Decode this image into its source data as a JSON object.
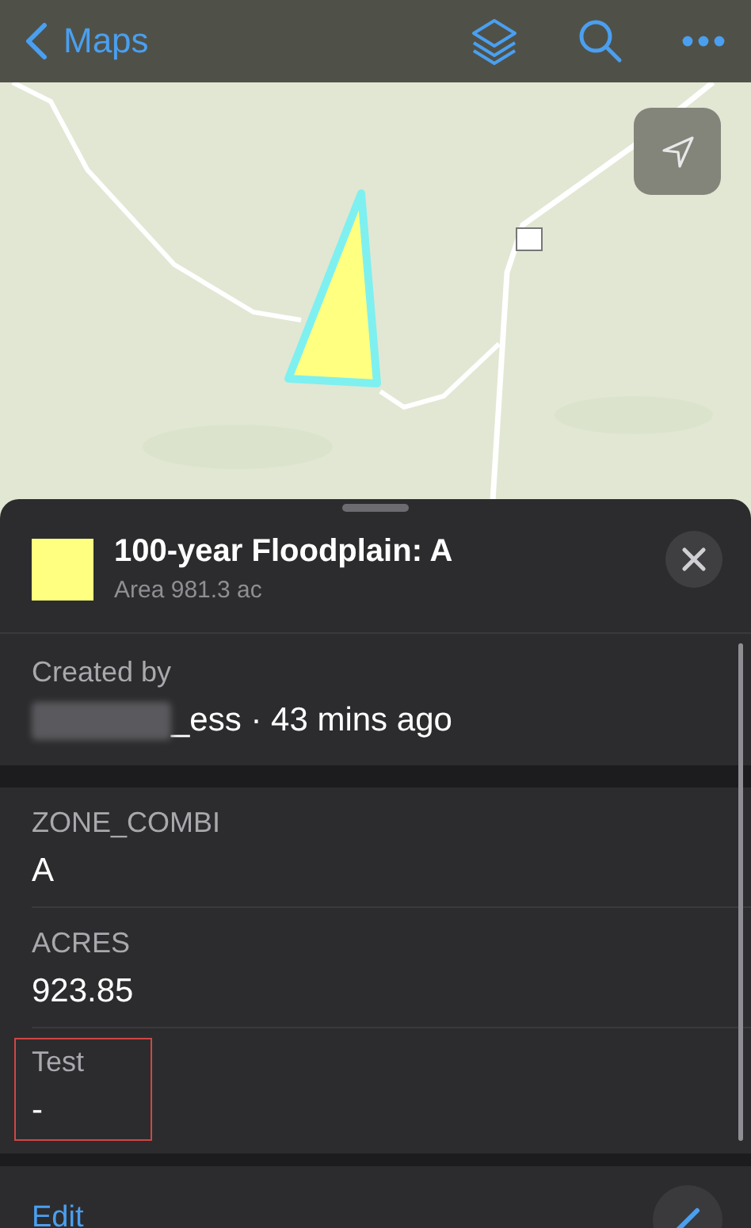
{
  "nav": {
    "back_label": "Maps"
  },
  "feature": {
    "title": "100-year Floodplain: A",
    "subtitle": "Area 981.3 ac",
    "color": "#ffff80"
  },
  "created": {
    "label": "Created by",
    "value": "_ess · 43 mins ago",
    "redacted": true
  },
  "fields": [
    {
      "label": "ZONE_COMBI",
      "value": "A",
      "highlighted": false
    },
    {
      "label": "ACRES",
      "value": "923.85",
      "highlighted": false
    },
    {
      "label": "Test",
      "value": "-",
      "highlighted": true
    }
  ],
  "footer": {
    "action": "Edit"
  }
}
